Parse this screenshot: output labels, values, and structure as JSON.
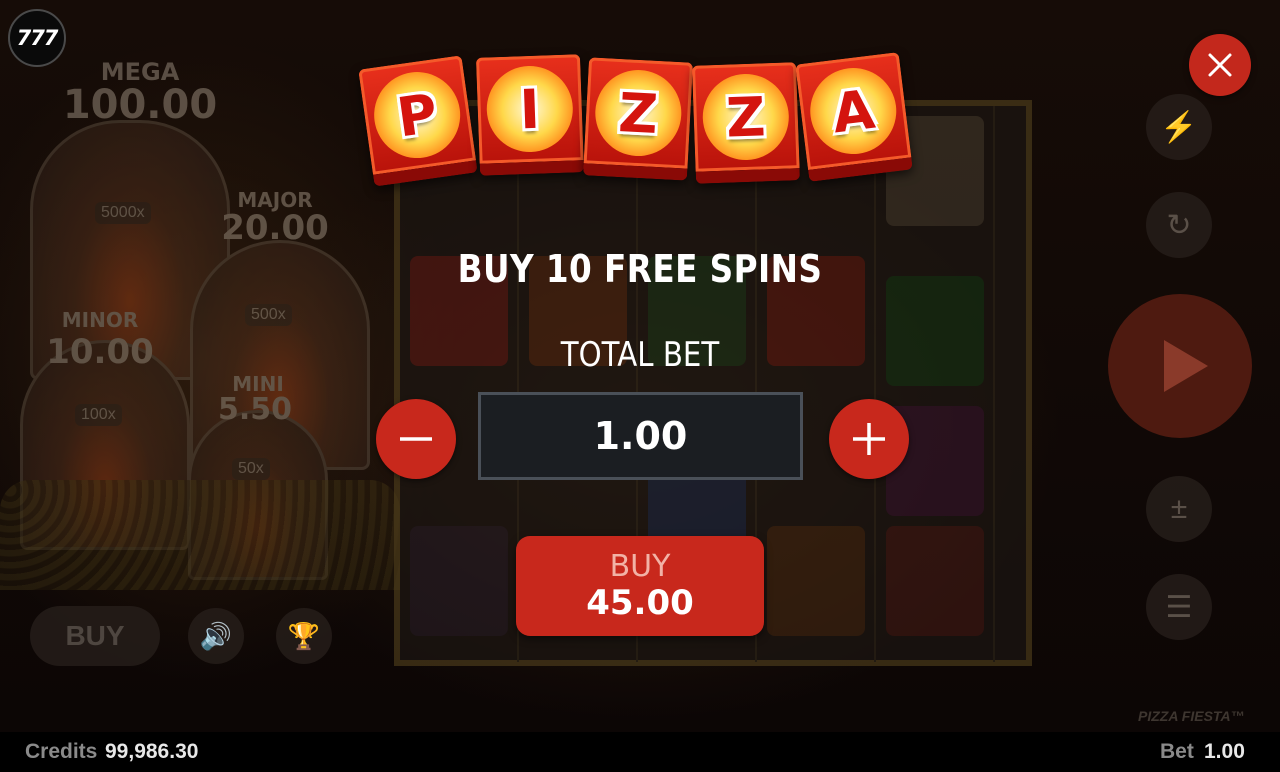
{
  "logo": {
    "text": "777"
  },
  "background": {
    "jackpots": [
      {
        "label": "MEGA",
        "value": "100.00",
        "multiplier": "5000x"
      },
      {
        "label": "MAJOR",
        "value": "20.00",
        "multiplier": "500x"
      },
      {
        "label": "MINOR",
        "value": "10.00",
        "multiplier": "100x"
      },
      {
        "label": "MINI",
        "value": "5.50",
        "multiplier": "50x"
      }
    ],
    "buy_label": "BUY",
    "game_name": "PIZZA FIESTA™"
  },
  "title": {
    "letters": [
      "P",
      "I",
      "Z",
      "Z",
      "A"
    ]
  },
  "dialog": {
    "heading": "BUY 10 FREE SPINS",
    "total_bet_label": "TOTAL BET",
    "bet_value": "1.00",
    "buy_label": "BUY",
    "buy_price": "45.00"
  },
  "footer": {
    "credits_label": "Credits",
    "credits_value": "99,986.30",
    "bet_label": "Bet",
    "bet_value": "1.00"
  },
  "colors": {
    "accent_red": "#c8281c",
    "input_bg": "#1b1e22",
    "footer_bg": "#000000"
  }
}
